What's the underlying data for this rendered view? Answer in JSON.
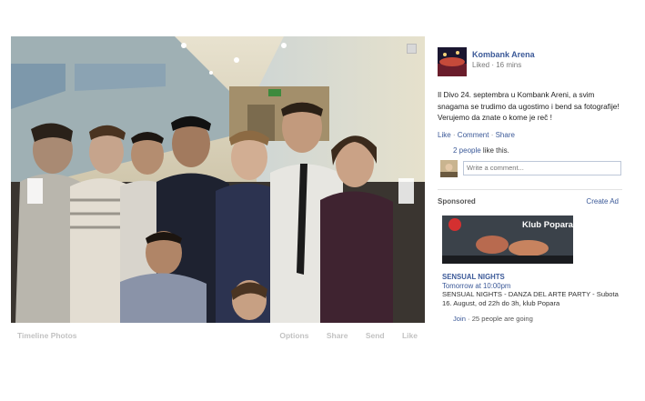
{
  "viewer": {
    "album_label": "Timeline Photos",
    "actions": [
      "Options",
      "Share",
      "Send",
      "Like"
    ]
  },
  "post": {
    "page_name": "Kombank Arena",
    "meta": "Liked · 16 mins",
    "text": "Il Divo 24. septembra u Kombank Areni, a svim snagama se trudimo da ugostimo i bend sa fotografije! Verujemo da znate o kome je reč     !",
    "like": "Like",
    "comment": "Comment",
    "share": "Share",
    "likes_count": "2 people",
    "likes_suffix": " like this.",
    "comment_placeholder": "Write a comment..."
  },
  "sponsored": {
    "label": "Sponsored",
    "create_ad": "Create Ad",
    "ad_image_text": "Klub Popara",
    "ad_title": "SENSUAL NIGHTS",
    "ad_when": "Tomorrow at 10:00pm",
    "ad_desc": "SENSUAL NIGHTS - DANZA DEL ARTE PARTY - Subota 16. August, od 22h do 3h, klub Popara",
    "join": "Join",
    "going": "25 people are going"
  },
  "colors": {
    "link": "#3b5998",
    "muted": "#c2c2c2"
  }
}
